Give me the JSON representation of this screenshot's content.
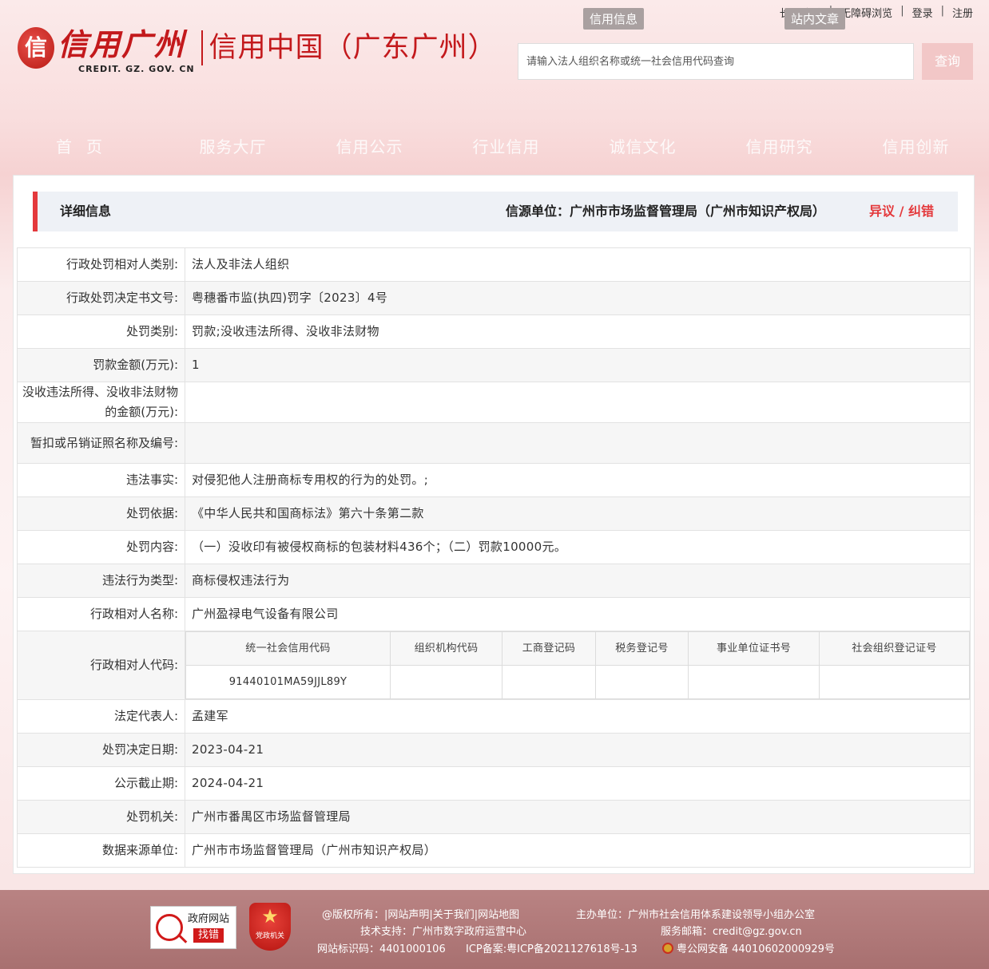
{
  "site": {
    "logo_seal": "信",
    "logo_title": "信用广州",
    "logo_sub": "CREDIT. GZ. GOV. CN",
    "logo_cn": "信用中国（广东广州）"
  },
  "toplinks": {
    "elder": "长者助手",
    "barrier_free": "无障碍浏览",
    "login": "登录",
    "register": "注册",
    "sep": "|"
  },
  "search": {
    "tab_credit": "信用信息",
    "tab_site": "站内文章",
    "placeholder": "请输入法人组织名称或统一社会信用代码查询",
    "button": "查询"
  },
  "nav": [
    "首页",
    "服务大厅",
    "信用公示",
    "行业信用",
    "诚信文化",
    "信用研究",
    "信用创新"
  ],
  "detail": {
    "title": "详细信息",
    "source_label": "信源单位：",
    "source_value": "广州市市场监督管理局（广州市知识产权局）",
    "dispute": "异议 / 纠错"
  },
  "rows": [
    {
      "label": "行政处罚相对人类别:",
      "value": "法人及非法人组织"
    },
    {
      "label": "行政处罚决定书文号:",
      "value": "粤穗番市监(执四)罚字〔2023〕4号"
    },
    {
      "label": "处罚类别:",
      "value": "罚款;没收违法所得、没收非法财物"
    },
    {
      "label": "罚款金额(万元):",
      "value": "1"
    },
    {
      "label": "没收违法所得、没收非法财物的金额(万元):",
      "value": ""
    },
    {
      "label": "暂扣或吊销证照名称及编号:",
      "value": ""
    },
    {
      "label": "违法事实:",
      "value": "对侵犯他人注册商标专用权的行为的处罚。;"
    },
    {
      "label": "处罚依据:",
      "value": "《中华人民共和国商标法》第六十条第二款"
    },
    {
      "label": "处罚内容:",
      "value": "（一）没收印有被侵权商标的包装材料436个；（二）罚款10000元。"
    },
    {
      "label": "违法行为类型:",
      "value": "商标侵权违法行为"
    },
    {
      "label": "行政相对人名称:",
      "value": "广州盈禄电气设备有限公司"
    }
  ],
  "codes": {
    "label": "行政相对人代码:",
    "headers": [
      "统一社会信用代码",
      "组织机构代码",
      "工商登记码",
      "税务登记号",
      "事业单位证书号",
      "社会组织登记证号"
    ],
    "values": [
      "91440101MA59JJL89Y",
      "",
      "",
      "",
      "",
      ""
    ]
  },
  "rows2": [
    {
      "label": "法定代表人:",
      "value": "孟建军"
    },
    {
      "label": "处罚决定日期:",
      "value": "2023-04-21"
    },
    {
      "label": "公示截止期:",
      "value": "2024-04-21"
    },
    {
      "label": "处罚机关:",
      "value": "广州市番禺区市场监督管理局"
    },
    {
      "label": "数据来源单位:",
      "value": "广州市市场监督管理局（广州市知识产权局）"
    }
  ],
  "footer": {
    "gov_badge_top": "政府网站",
    "gov_badge_bottom": "找错",
    "party_badge": "党政机关",
    "links": "@版权所有：|网站声明|关于我们|网站地图",
    "host": "主办单位：广州市社会信用体系建设领导小组办公室",
    "tech": "技术支持：广州市数字政府运营中心",
    "email": "服务邮箱：credit@gz.gov.cn",
    "site_id": "网站标识码：4401000106",
    "icp": "ICP备案:粤ICP备2021127618号-13",
    "police": "粤公网安备 44010602000929号"
  },
  "colors": {
    "accent": "#e4393c",
    "brand": "#c3191c",
    "footer": "#a87070"
  }
}
